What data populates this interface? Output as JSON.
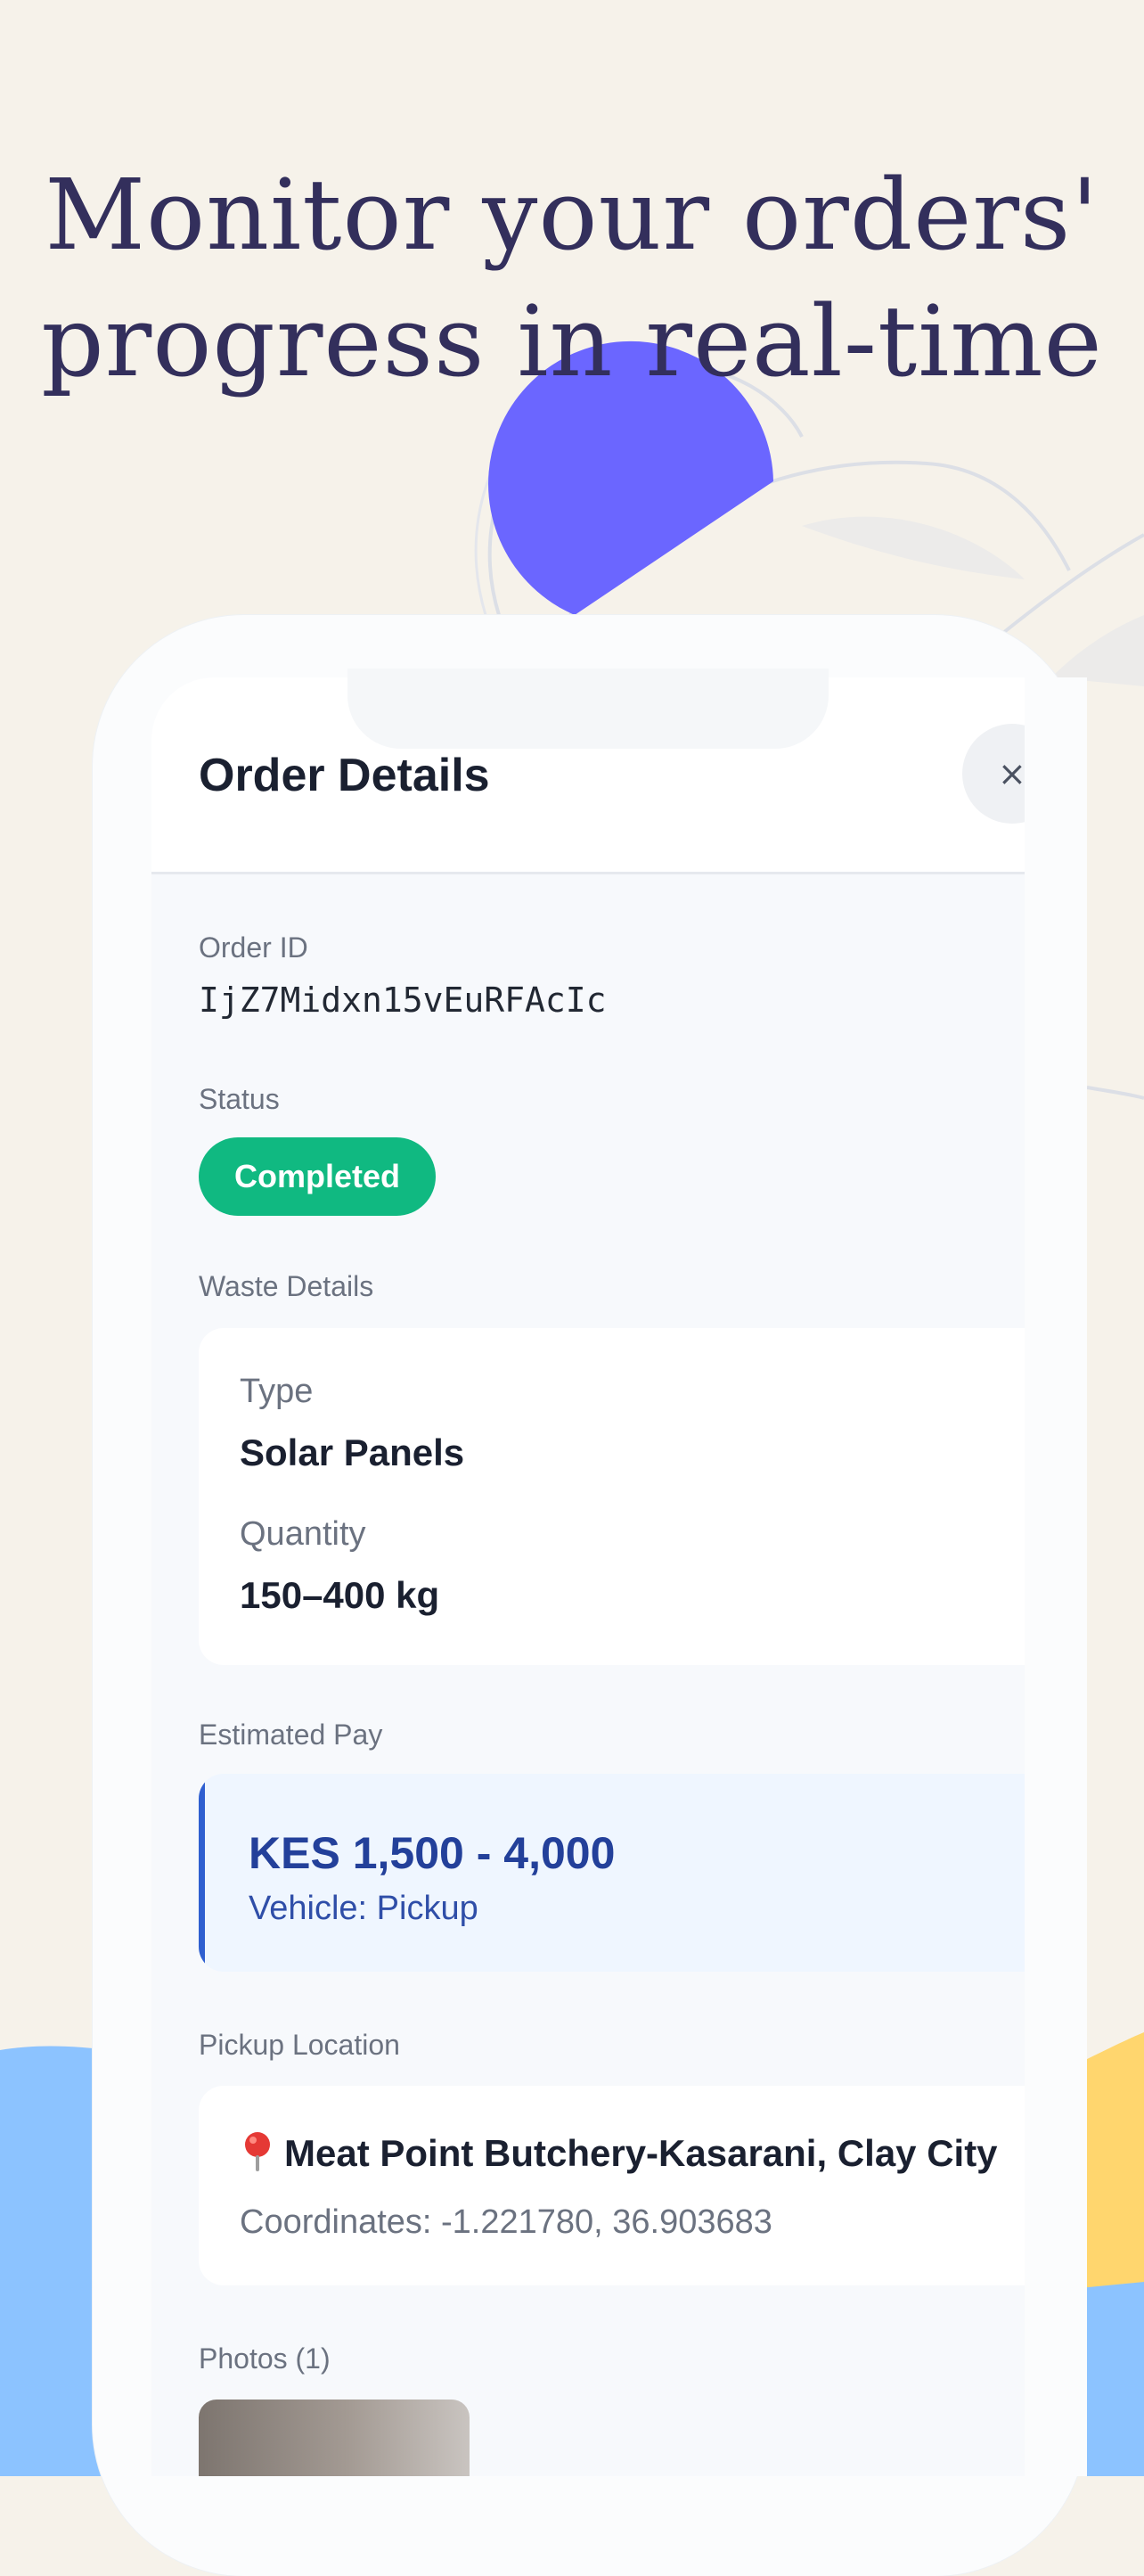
{
  "headline": {
    "line1": "Monitor your orders'",
    "line2": "progress in real-time"
  },
  "screen": {
    "title": "Order Details",
    "close_label": "×",
    "order_id": {
      "label": "Order ID",
      "value": "IjZ7Midxn15vEuRFAcIc"
    },
    "status": {
      "label": "Status",
      "value": "Completed",
      "color": "#10b981"
    },
    "waste_details": {
      "label": "Waste Details",
      "type_label": "Type",
      "type_value": "Solar Panels",
      "quantity_label": "Quantity",
      "quantity_value": "150–400 kg"
    },
    "estimated_pay": {
      "label": "Estimated Pay",
      "amount": "KES 1,500 - 4,000",
      "vehicle": "Vehicle: Pickup"
    },
    "pickup_location": {
      "label": "Pickup Location",
      "icon": "pin-icon",
      "name": "Meat Point Butchery-Kasarani, Clay City",
      "coordinates": "Coordinates: -1.221780, 36.903683"
    },
    "photos": {
      "label": "Photos (1)"
    }
  },
  "colors": {
    "background": "#f6f2ea",
    "headline": "#332f5c",
    "accent_purple": "#6b66ff",
    "accent_blue": "#8cc3ff",
    "accent_yellow": "#ffd66e"
  }
}
